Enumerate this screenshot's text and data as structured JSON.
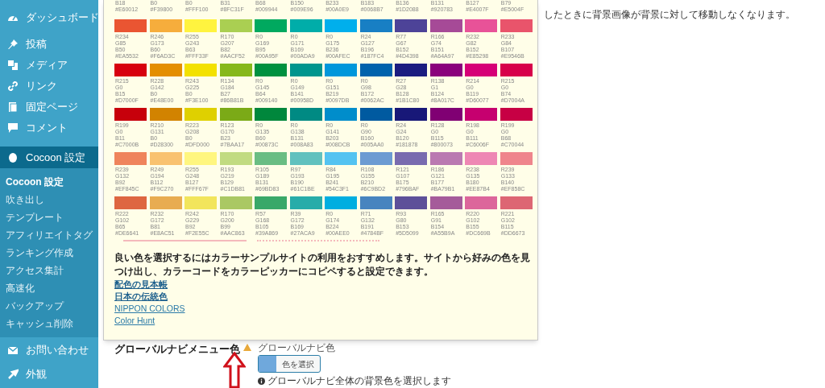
{
  "sidebar": {
    "items": [
      {
        "label": "ダッシュボード",
        "selected": false
      },
      {
        "label": "投稿",
        "selected": false
      },
      {
        "label": "メディア",
        "selected": false
      },
      {
        "label": "リンク",
        "selected": false
      },
      {
        "label": "固定ページ",
        "selected": false
      },
      {
        "label": "コメント",
        "selected": false
      },
      {
        "label": "Cocoon 設定",
        "selected": true,
        "children": [
          {
            "label": "Cocoon 設定",
            "selected": true
          },
          {
            "label": "吹き出し",
            "selected": false
          },
          {
            "label": "テンプレート",
            "selected": false
          },
          {
            "label": "アフィリエイトタグ",
            "selected": false
          },
          {
            "label": "ランキング作成",
            "selected": false
          },
          {
            "label": "アクセス集計",
            "selected": false
          },
          {
            "label": "高速化",
            "selected": false
          },
          {
            "label": "バックアップ",
            "selected": false
          },
          {
            "label": "キャッシュ削除",
            "selected": false
          }
        ]
      },
      {
        "label": "お問い合わせ",
        "selected": false
      },
      {
        "label": "外観",
        "selected": false
      }
    ]
  },
  "top_text": "したときに背景画像が背景に対して移動しなくなります。",
  "palette": {
    "partial_row": [
      {
        "b": "B18",
        "hex": "#E60012"
      },
      {
        "b": "B0",
        "hex": "#F39800"
      },
      {
        "b": "B0",
        "hex": "#FFF100"
      },
      {
        "b": "B31",
        "hex": "#8FC31F"
      },
      {
        "b": "B68",
        "hex": "#009944"
      },
      {
        "b": "B150",
        "hex": "#009E96"
      },
      {
        "b": "B233",
        "hex": "#00A0E9"
      },
      {
        "b": "B183",
        "hex": "#0068B7"
      },
      {
        "b": "B136",
        "hex": "#1D2088"
      },
      {
        "b": "B131",
        "hex": "#920783"
      },
      {
        "b": "B127",
        "hex": "#E4007F"
      },
      {
        "b": "B79",
        "hex": "#E5004F"
      }
    ],
    "rows": [
      [
        {
          "r": "R234",
          "g": "G85",
          "b": "B50",
          "hex": "#EA5532",
          "color": "#ea5532"
        },
        {
          "r": "R246",
          "g": "G173",
          "b": "B60",
          "hex": "#F6AD3C",
          "color": "#f6ad3c"
        },
        {
          "r": "R255",
          "g": "G243",
          "b": "B63",
          "hex": "#FFF33F",
          "color": "#fff33f"
        },
        {
          "r": "R170",
          "g": "G207",
          "b": "B82",
          "hex": "#AACF52",
          "color": "#aacf52"
        },
        {
          "r": "R0",
          "g": "G169",
          "b": "B95",
          "hex": "#00A95F",
          "color": "#00a95f"
        },
        {
          "r": "R0",
          "g": "G171",
          "b": "B169",
          "hex": "#00ADA9",
          "color": "#00ada9"
        },
        {
          "r": "R0",
          "g": "G175",
          "b": "B236",
          "hex": "#00AFEC",
          "color": "#00afec"
        },
        {
          "r": "R24",
          "g": "G127",
          "b": "B196",
          "hex": "#187FC4",
          "color": "#187fc4"
        },
        {
          "r": "R77",
          "g": "G67",
          "b": "B152",
          "hex": "#4D4398",
          "color": "#4d4398"
        },
        {
          "r": "R166",
          "g": "G74",
          "b": "B151",
          "hex": "#A64A97",
          "color": "#a64a97"
        },
        {
          "r": "R232",
          "g": "G82",
          "b": "B152",
          "hex": "#E85298",
          "color": "#e85298"
        },
        {
          "r": "R233",
          "g": "G84",
          "b": "B107",
          "hex": "#E9546B",
          "color": "#e9546b"
        }
      ],
      [
        {
          "r": "R215",
          "g": "G0",
          "b": "B15",
          "hex": "#D7000F",
          "color": "#d7000f"
        },
        {
          "r": "R228",
          "g": "G142",
          "b": "B0",
          "hex": "#E48E00",
          "color": "#e48e00"
        },
        {
          "r": "R243",
          "g": "G225",
          "b": "B0",
          "hex": "#F3E100",
          "color": "#f3e100"
        },
        {
          "r": "R134",
          "g": "G184",
          "b": "B27",
          "hex": "#86B81B",
          "color": "#86b81b"
        },
        {
          "r": "R0",
          "g": "G145",
          "b": "B64",
          "hex": "#009140",
          "color": "#009140"
        },
        {
          "r": "R0",
          "g": "G149",
          "b": "B141",
          "hex": "#00958D",
          "color": "#00958d"
        },
        {
          "r": "R0",
          "g": "G151",
          "b": "B219",
          "hex": "#0097DB",
          "color": "#0097db"
        },
        {
          "r": "R0",
          "g": "G98",
          "b": "B172",
          "hex": "#0062AC",
          "color": "#0062ac"
        },
        {
          "r": "R27",
          "g": "G28",
          "b": "B128",
          "hex": "#1B1C80",
          "color": "#1b1c80"
        },
        {
          "r": "R138",
          "g": "G1",
          "b": "B124",
          "hex": "#8A017C",
          "color": "#8a017c"
        },
        {
          "r": "R214",
          "g": "G0",
          "b": "B119",
          "hex": "#D60077",
          "color": "#d60077"
        },
        {
          "r": "R215",
          "g": "G0",
          "b": "B74",
          "hex": "#D7004A",
          "color": "#d7004a"
        }
      ],
      [
        {
          "r": "R199",
          "g": "G0",
          "b": "B11",
          "hex": "#C7000B",
          "color": "#c7000b"
        },
        {
          "r": "R210",
          "g": "G131",
          "b": "B0",
          "hex": "#D28300",
          "color": "#d28300"
        },
        {
          "r": "R223",
          "g": "G208",
          "b": "B0",
          "hex": "#DFD000",
          "color": "#dfd000"
        },
        {
          "r": "R123",
          "g": "G170",
          "b": "B23",
          "hex": "#7BAA17",
          "color": "#7baa17"
        },
        {
          "r": "R0",
          "g": "G135",
          "b": "B60",
          "hex": "#00873C",
          "color": "#00873c"
        },
        {
          "r": "R0",
          "g": "G138",
          "b": "B131",
          "hex": "#008A83",
          "color": "#008a83"
        },
        {
          "r": "R0",
          "g": "G141",
          "b": "B203",
          "hex": "#008DCB",
          "color": "#008dcb"
        },
        {
          "r": "R0",
          "g": "G90",
          "b": "B160",
          "hex": "#005AA0",
          "color": "#005aa0"
        },
        {
          "r": "R24",
          "g": "G24",
          "b": "B120",
          "hex": "#181878",
          "color": "#181878"
        },
        {
          "r": "R128",
          "g": "G0",
          "b": "B115",
          "hex": "#800073",
          "color": "#800073"
        },
        {
          "r": "R198",
          "g": "G0",
          "b": "B111",
          "hex": "#C6006F",
          "color": "#c6006f"
        },
        {
          "r": "R199",
          "g": "G0",
          "b": "B68",
          "hex": "#C70044",
          "color": "#c70044"
        }
      ],
      [
        {
          "r": "R239",
          "g": "G132",
          "b": "B92",
          "hex": "#EF845C",
          "color": "#ef845c"
        },
        {
          "r": "R249",
          "g": "G194",
          "b": "B112",
          "hex": "#F9C270",
          "color": "#f9c270"
        },
        {
          "r": "R255",
          "g": "G248",
          "b": "B127",
          "hex": "#FFF67F",
          "color": "#fff67f"
        },
        {
          "r": "R193",
          "g": "G219",
          "b": "B129",
          "hex": "#C1DB81",
          "color": "#c1db81"
        },
        {
          "r": "R105",
          "g": "G189",
          "b": "B131",
          "hex": "#69BD83",
          "color": "#69bd83"
        },
        {
          "r": "R97",
          "g": "G193",
          "b": "B190",
          "hex": "#61C1BE",
          "color": "#61c1be"
        },
        {
          "r": "R84",
          "g": "G195",
          "b": "B241",
          "hex": "#54C3F1",
          "color": "#54c3f1"
        },
        {
          "r": "R108",
          "g": "G155",
          "b": "B210",
          "hex": "#6C9BD2",
          "color": "#6c9bd2"
        },
        {
          "r": "R121",
          "g": "G107",
          "b": "B175",
          "hex": "#796BAF",
          "color": "#796baf"
        },
        {
          "r": "R186",
          "g": "G121",
          "b": "B177",
          "hex": "#BA79B1",
          "color": "#ba79b1"
        },
        {
          "r": "R238",
          "g": "G135",
          "b": "B180",
          "hex": "#EE87B4",
          "color": "#ee87b4"
        },
        {
          "r": "R239",
          "g": "G133",
          "b": "B140",
          "hex": "#EF858C",
          "color": "#ef858c"
        }
      ],
      [
        {
          "r": "R222",
          "g": "G102",
          "b": "B65",
          "hex": "#DE6641",
          "color": "#de6641"
        },
        {
          "r": "R232",
          "g": "G172",
          "b": "B81",
          "hex": "#E8AC51",
          "color": "#e8ac51"
        },
        {
          "r": "R242",
          "g": "G229",
          "b": "B92",
          "hex": "#F2E55C",
          "color": "#f2e55c"
        },
        {
          "r": "R170",
          "g": "G200",
          "b": "B99",
          "hex": "#AAC863",
          "color": "#aac863"
        },
        {
          "r": "R57",
          "g": "G168",
          "b": "B105",
          "hex": "#39A869",
          "color": "#39a869"
        },
        {
          "r": "R39",
          "g": "G172",
          "b": "B169",
          "hex": "#27ACA9",
          "color": "#27aca9"
        },
        {
          "r": "R0",
          "g": "G174",
          "b": "B224",
          "hex": "#00AEE0",
          "color": "#00aee0"
        },
        {
          "r": "R71",
          "g": "G132",
          "b": "B191",
          "hex": "#4784BF",
          "color": "#4784bf"
        },
        {
          "r": "R93",
          "g": "G80",
          "b": "B153",
          "hex": "#5D5099",
          "color": "#5d5099"
        },
        {
          "r": "R165",
          "g": "G91",
          "b": "B154",
          "hex": "#A55B9A",
          "color": "#a55b9a"
        },
        {
          "r": "R220",
          "g": "G102",
          "b": "B155",
          "hex": "#DC669B",
          "color": "#dc669b"
        },
        {
          "r": "R221",
          "g": "G102",
          "b": "B115",
          "hex": "#DD6673",
          "color": "#dd6673"
        }
      ]
    ],
    "advice": "良い色を選択するにはカラーサンプルサイトの利用をおすすめします。サイトから好みの色を見つけ出し、カラーコードをカラーピッカーにコピペすると設定できます。",
    "links": [
      "配色の見本帳",
      "日本の伝統色",
      "NIPPON COLORS",
      "Color Hunt"
    ]
  },
  "setting": {
    "label": "グローバルナビメニュー色",
    "sublabel": "グローバルナビ色",
    "color": "#6fa8dc",
    "button_label": "色を選択",
    "help_text": "グローバルナビ全体の背景色を選択します"
  }
}
